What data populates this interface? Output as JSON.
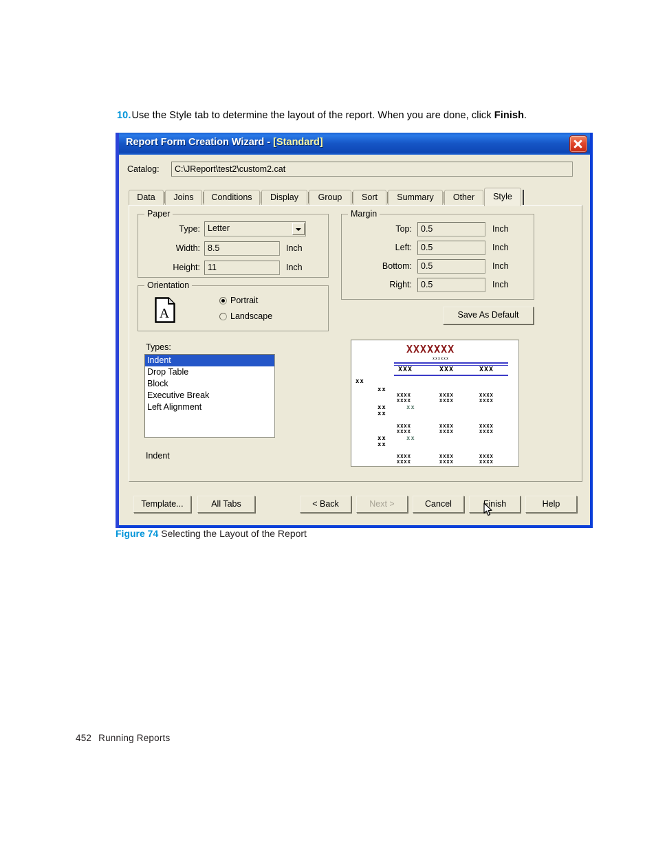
{
  "document": {
    "step": {
      "number": "10.",
      "text_before": "Use the Style tab to determine the layout of the report. When you are done, click ",
      "bold_word": "Finish",
      "text_after": "."
    },
    "caption": {
      "figure_label": "Figure 74",
      "caption_text": "Selecting the Layout of the Report"
    },
    "footer": {
      "page_number": "452",
      "section": "Running Reports"
    },
    "accent_color": "#0094d9"
  },
  "dialog": {
    "title_main": "Report Form Creation Wizard",
    "title_dash": " - ",
    "title_bracket": "[Standard]",
    "close_icon": "close-icon",
    "titlebar_color": "#1656c6",
    "border_color": "#0a3fd8",
    "face_color": "#ece9d8",
    "catalog": {
      "label": "Catalog:",
      "value": "C:\\JReport\\test2\\custom2.cat"
    },
    "tabs": [
      {
        "label": "Data",
        "selected": false
      },
      {
        "label": "Joins",
        "selected": false
      },
      {
        "label": "Conditions",
        "selected": false
      },
      {
        "label": "Display",
        "selected": false
      },
      {
        "label": "Group",
        "selected": false
      },
      {
        "label": "Sort",
        "selected": false
      },
      {
        "label": "Summary",
        "selected": false
      },
      {
        "label": "Other",
        "selected": false
      },
      {
        "label": "Style",
        "selected": true
      }
    ],
    "paper": {
      "group_title": "Paper",
      "type_label": "Type:",
      "type_value": "Letter",
      "type_options": [
        "Letter"
      ],
      "width_label": "Width:",
      "width_value": "8.5",
      "width_unit": "Inch",
      "height_label": "Height:",
      "height_value": "11",
      "height_unit": "Inch"
    },
    "margin": {
      "group_title": "Margin",
      "rows": [
        {
          "label": "Top:",
          "value": "0.5",
          "unit": "Inch"
        },
        {
          "label": "Left:",
          "value": "0.5",
          "unit": "Inch"
        },
        {
          "label": "Bottom:",
          "value": "0.5",
          "unit": "Inch"
        },
        {
          "label": "Right:",
          "value": "0.5",
          "unit": "Inch"
        }
      ],
      "save_default_label": "Save As Default"
    },
    "orientation": {
      "group_title": "Orientation",
      "icon": "page-portrait-icon",
      "icon_letter": "A",
      "portrait_label": "Portrait",
      "landscape_label": "Landscape",
      "selected": "Portrait"
    },
    "types": {
      "label": "Types:",
      "items": [
        "Indent",
        "Drop Table",
        "Block",
        "Executive Break",
        "Left Alignment"
      ],
      "selected": "Indent",
      "selected_description": "Indent"
    },
    "preview": {
      "name": "style-preview",
      "title_color": "#8b1a1a",
      "rule_color": "#3b3bc8",
      "header_color": "#000000",
      "accent_x_color": "#5f7f72",
      "title_row": "XXXXXXX",
      "subtitle_row": "xxxxxx",
      "column_headers": [
        "XXX",
        "XXX",
        "XXX"
      ],
      "group_marks": [
        "xx",
        "xx",
        "xx",
        "xx",
        "xx",
        "xx"
      ],
      "detail_block": "XXXX",
      "accent_mark": "xx"
    },
    "buttons": {
      "template": "Template...",
      "all_tabs": "All Tabs",
      "back": "< Back",
      "next": "Next >",
      "next_disabled": true,
      "cancel": "Cancel",
      "finish": "Finish",
      "help": "Help"
    },
    "cursor": {
      "name": "mouse-pointer",
      "over": "Finish"
    }
  }
}
